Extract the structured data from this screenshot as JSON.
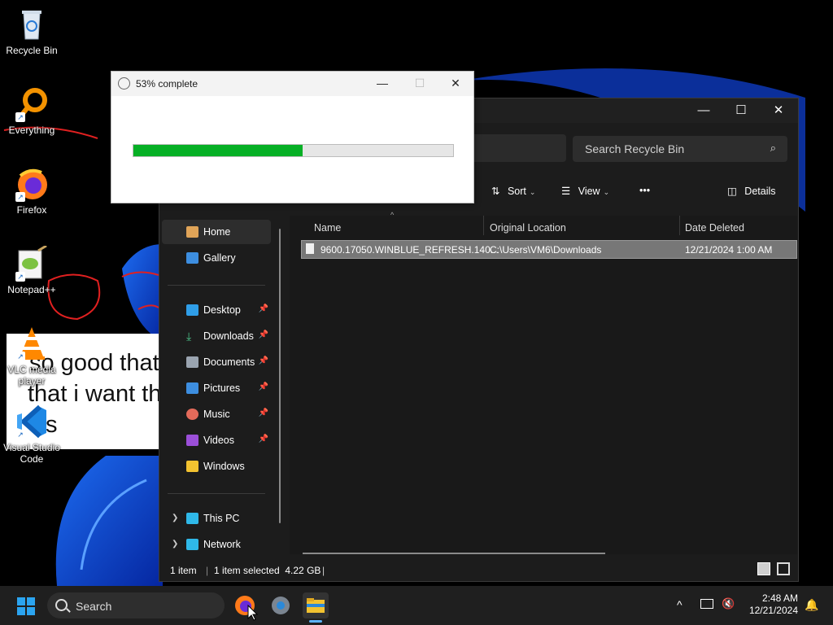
{
  "desktop": {
    "icons": [
      {
        "label": "Recycle Bin"
      },
      {
        "label": "Everything"
      },
      {
        "label": "Firefox"
      },
      {
        "label": "Notepad++"
      },
      {
        "label": "VLC media player"
      },
      {
        "label": "Visual Studio Code"
      }
    ],
    "stray_window_lines": [
      "so good that",
      "that i want th",
      "s"
    ]
  },
  "progress_dialog": {
    "title": "53% complete",
    "progress_percent": 53,
    "progress_color": "#06b025"
  },
  "explorer": {
    "search_placeholder": "Search Recycle Bin",
    "toolbar": {
      "sort": "Sort",
      "view": "View",
      "more": "•••",
      "details": "Details"
    },
    "nav": {
      "home": "Home",
      "gallery": "Gallery",
      "pinned": [
        "Desktop",
        "Downloads",
        "Documents",
        "Pictures",
        "Music",
        "Videos"
      ],
      "windows": "Windows",
      "this_pc": "This PC",
      "network": "Network"
    },
    "columns": {
      "name": "Name",
      "original_location": "Original Location",
      "date_deleted": "Date Deleted"
    },
    "files": [
      {
        "name": "9600.17050.WINBLUE_REFRESH.140...",
        "original_location": "C:\\Users\\VM6\\Downloads",
        "date_deleted": "12/21/2024 1:00 AM"
      }
    ],
    "status": {
      "items": "1 item",
      "selected": "1 item selected  4.22 GB"
    }
  },
  "taskbar": {
    "search_label": "Search",
    "time": "2:48 AM",
    "date": "12/21/2024"
  },
  "colors": {
    "accent": "#0078d4",
    "explorer_bg": "#1c1c1c",
    "wallpaper_blue": "#0a44c8"
  }
}
